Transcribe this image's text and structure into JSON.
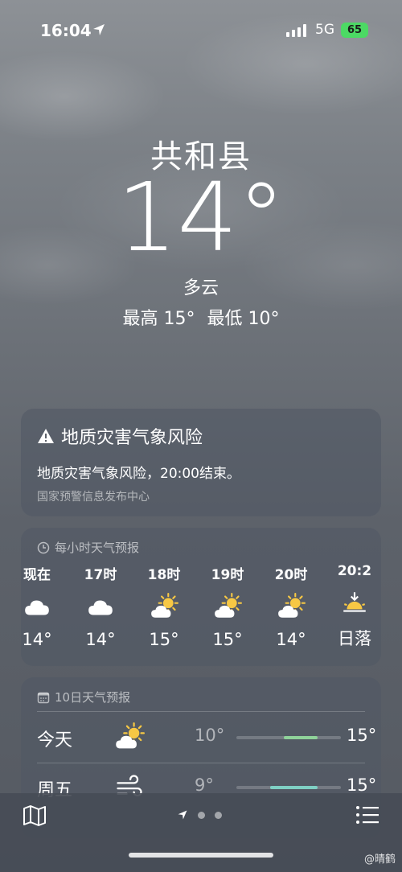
{
  "status_bar": {
    "time": "16:04",
    "network": "5G",
    "battery": "65"
  },
  "header": {
    "city": "共和县",
    "temperature": "14°",
    "condition": "多云",
    "high": "最高 15°",
    "low": "最低 10°"
  },
  "alert": {
    "title": "地质灾害气象风险",
    "body": "地质灾害气象风险，20:00结束。",
    "source": "国家预警信息发布中心"
  },
  "hourly": {
    "title": "每小时天气预报",
    "hours": [
      {
        "label": "现在",
        "icon": "cloud-icon",
        "temp": "14°"
      },
      {
        "label": "17时",
        "icon": "cloud-icon",
        "temp": "14°"
      },
      {
        "label": "18时",
        "icon": "partly-sunny-icon",
        "temp": "15°"
      },
      {
        "label": "19时",
        "icon": "partly-sunny-icon",
        "temp": "15°"
      },
      {
        "label": "20时",
        "icon": "partly-sunny-icon",
        "temp": "14°"
      },
      {
        "label": "20:2",
        "icon": "sunset-icon",
        "temp": "日落"
      }
    ]
  },
  "daily": {
    "title": "10日天气预报",
    "days": [
      {
        "name": "今天",
        "icon": "partly-sunny-icon",
        "low": "10°",
        "high": "15°",
        "range_start": 0.45,
        "range_end": 0.78,
        "color": "#8fd39a"
      },
      {
        "name": "周五",
        "icon": "wind-icon",
        "low": "9°",
        "high": "15°",
        "range_start": 0.32,
        "range_end": 0.78,
        "color": "#7fd0c4"
      }
    ]
  },
  "colors": {
    "sun": "#f7c844",
    "bar_green": "#8fd39a",
    "bar_teal": "#7fd0c4",
    "battery": "#4cd964"
  },
  "watermark": "@晴鹤"
}
